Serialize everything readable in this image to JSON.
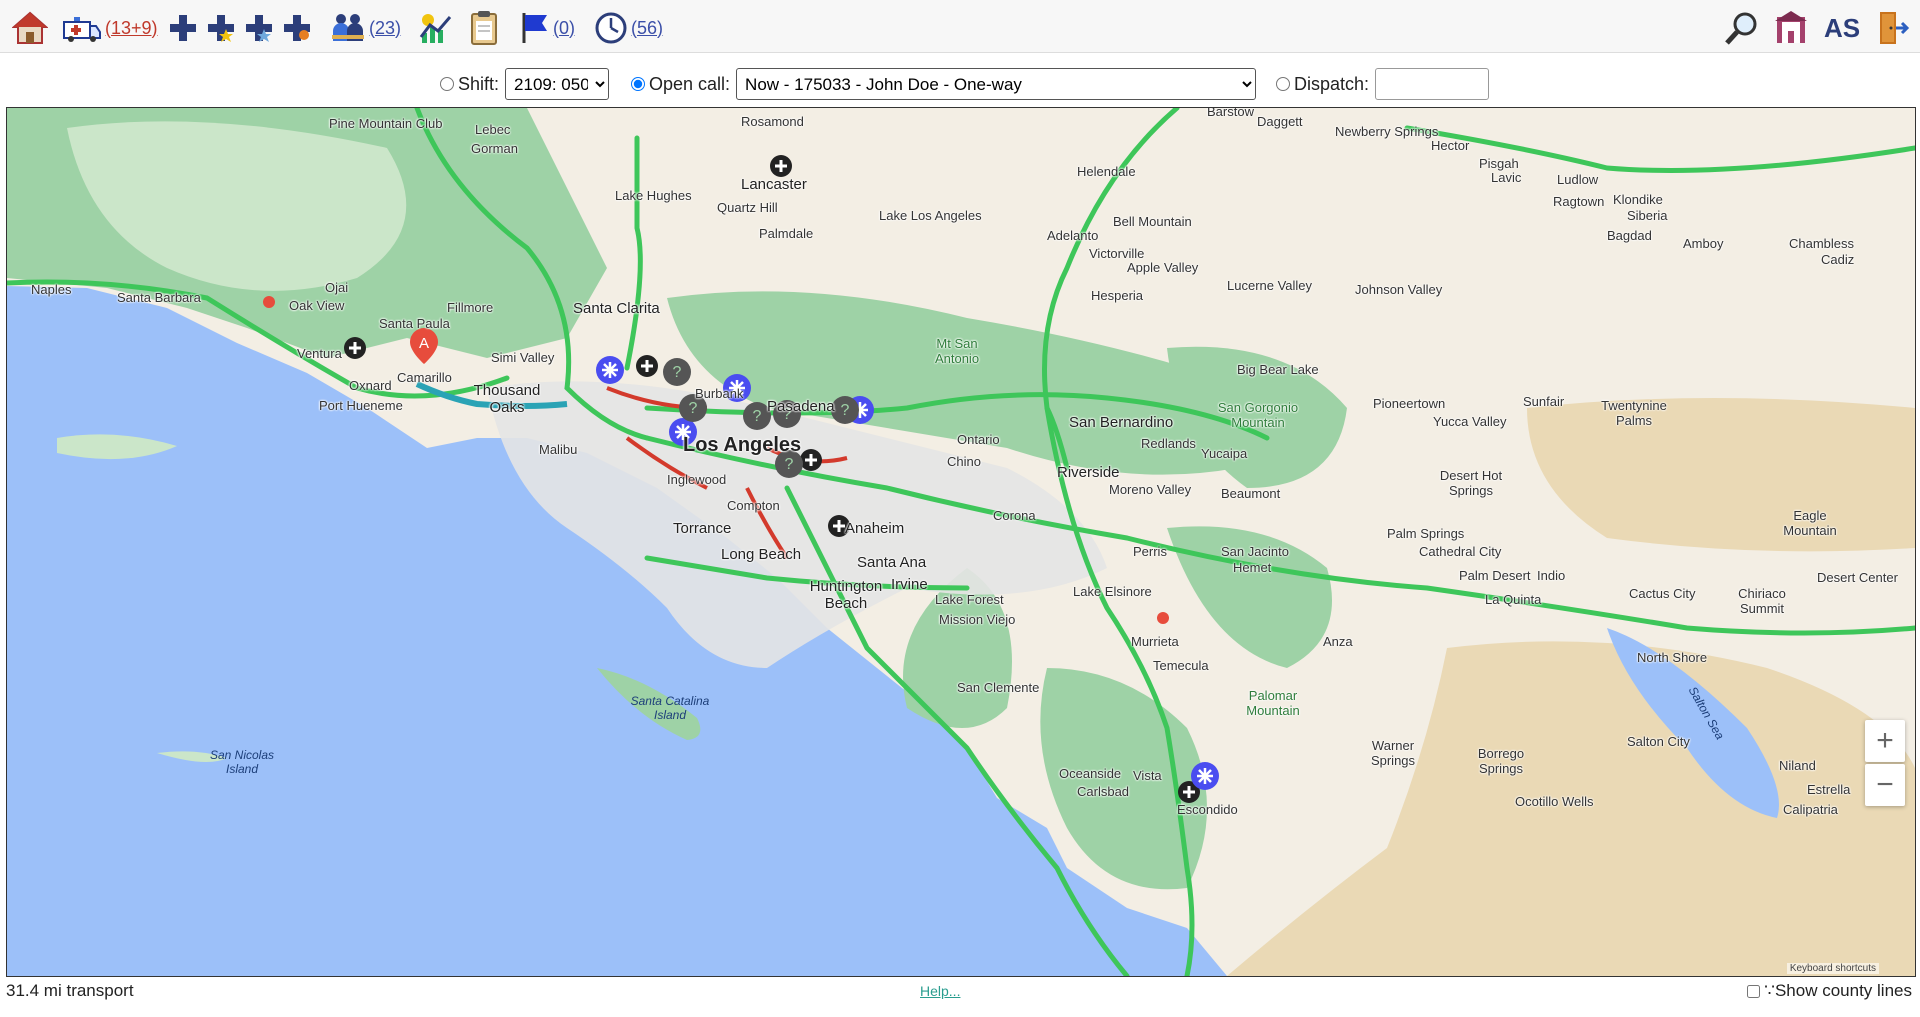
{
  "toolbar": {
    "ambulance_count": "(13+9)",
    "crew_count": "(23)",
    "flag_count": "(0)",
    "clock_count": "(56)",
    "user_initials": "AS"
  },
  "controls": {
    "shift_label": "Shift:",
    "shift_value": "2109: 050",
    "open_call_label": "Open call:",
    "open_call_value": "Now - 175033 - John Doe  - One-way",
    "dispatch_label": "Dispatch:",
    "dispatch_value": ""
  },
  "map": {
    "labels": {
      "pine_mountain_club": "Pine Mountain Club",
      "lebec": "Lebec",
      "gorman": "Gorman",
      "rosamond": "Rosamond",
      "lancaster": "Lancaster",
      "quartz_hill": "Quartz Hill",
      "palmdale": "Palmdale",
      "lake_hughes": "Lake Hughes",
      "lake_los_angeles": "Lake Los Angeles",
      "barstow": "Barstow",
      "daggett": "Daggett",
      "newberry_springs": "Newberry Springs",
      "hector": "Hector",
      "pisgah": "Pisgah",
      "lavic": "Lavic",
      "ludlow": "Ludlow",
      "ragtown": "Ragtown",
      "klondike": "Klondike",
      "siberia": "Siberia",
      "bagdad": "Bagdad",
      "amboy": "Amboy",
      "chambless": "Chambless",
      "cadiz": "Cadiz",
      "helendale": "Helendale",
      "bell_mountain": "Bell Mountain",
      "adelanto": "Adelanto",
      "victorville": "Victorville",
      "apple_valley": "Apple Valley",
      "hesperia": "Hesperia",
      "lucerne_valley": "Lucerne Valley",
      "johnson_valley": "Johnson Valley",
      "naples": "Naples",
      "santa_barbara": "Santa Barbara",
      "ojai": "Ojai",
      "oak_view": "Oak View",
      "fillmore": "Fillmore",
      "santa_paula": "Santa Paula",
      "santa_clarita": "Santa Clarita",
      "ventura": "Ventura",
      "camarillo": "Camarillo",
      "oxnard": "Oxnard",
      "simi_valley": "Simi Valley",
      "thousand_oaks": "Thousand Oaks",
      "port_hueneme": "Port Hueneme",
      "malibu": "Malibu",
      "burbank": "Burbank",
      "pasadena": "Pasadena",
      "los_angeles": "Los Angeles",
      "inglewood": "Inglewood",
      "compton": "Compton",
      "torrance": "Torrance",
      "long_beach": "Long Beach",
      "anaheim": "Anaheim",
      "santa_ana": "Santa Ana",
      "irvine": "Irvine",
      "huntington_beach": "Huntington Beach",
      "lake_forest": "Lake Forest",
      "mission_viejo": "Mission Viejo",
      "san_clemente": "San Clemente",
      "oceanside": "Oceanside",
      "carlsbad": "Carlsbad",
      "vista": "Vista",
      "escondido": "Escondido",
      "mt_san_antonio": "Mt San Antonio",
      "ontario": "Ontario",
      "chino": "Chino",
      "corona": "Corona",
      "san_bernardino": "San Bernardino",
      "redlands": "Redlands",
      "riverside": "Riverside",
      "moreno_valley": "Moreno Valley",
      "big_bear_lake": "Big Bear Lake",
      "san_gorgonio_mountain": "San Gorgonio Mountain",
      "yucaipa": "Yucaipa",
      "beaumont": "Beaumont",
      "perris": "Perris",
      "san_jacinto": "San Jacinto",
      "hemet": "Hemet",
      "lake_elsinore": "Lake Elsinore",
      "murrieta": "Murrieta",
      "temecula": "Temecula",
      "anza": "Anza",
      "palomar_mountain": "Palomar Mountain",
      "warner_springs": "Warner Springs",
      "borrego_springs": "Borrego Springs",
      "ocotillo_wells": "Ocotillo Wells",
      "pioneertown": "Pioneertown",
      "yucca_valley": "Yucca Valley",
      "sunfair": "Sunfair",
      "twentynine_palms": "Twentynine Palms",
      "desert_hot_springs": "Desert Hot Springs",
      "palm_springs": "Palm Springs",
      "cathedral_city": "Cathedral City",
      "palm_desert": "Palm Desert",
      "indio": "Indio",
      "la_quinta": "La Quinta",
      "cactus_city": "Cactus City",
      "chiriaco_summit": "Chiriaco Summit",
      "eagle_mountain": "Eagle Mountain",
      "desert_center": "Desert Center",
      "north_shore": "North Shore",
      "salton_city": "Salton City",
      "salton_sea": "Salton Sea",
      "niland": "Niland",
      "calipatria": "Calipatria",
      "estrella": "Estrella",
      "santa_catalina_island": "Santa Catalina Island",
      "san_nicolas_island": "San Nicolas Island",
      "marker_a": "A"
    },
    "credit": "Keyboard shortcuts",
    "zoom_in": "+",
    "zoom_out": "−"
  },
  "footer": {
    "distance": "31.4 mi transport",
    "help": "Help...",
    "county_lines": "∵Show county lines"
  }
}
